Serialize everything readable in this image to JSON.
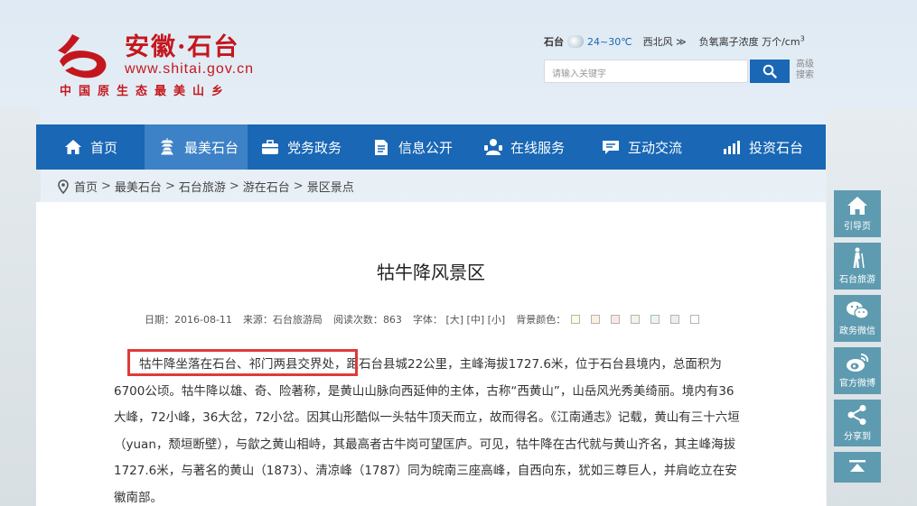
{
  "site": {
    "name": "安徽·石台",
    "url": "www.shitai.gov.cn",
    "slogan": "中国原生态最美山乡",
    "brand_color": "#c4171d"
  },
  "weather": {
    "city": "石台",
    "icon": "cloudy-icon",
    "temp": "24~30℃",
    "wind": "西北风 ≫",
    "ion_label": "负氧离子浓度 万个/cm",
    "ion_unit_sup": "3"
  },
  "search": {
    "placeholder": "请输入关键字",
    "advanced_label": "高级搜索"
  },
  "nav": {
    "accent": "#1967b5",
    "items": [
      {
        "label": "首页",
        "icon": "home-icon"
      },
      {
        "label": "最美石台",
        "icon": "pagoda-icon",
        "active": true
      },
      {
        "label": "党务政务",
        "icon": "briefcase-icon"
      },
      {
        "label": "信息公开",
        "icon": "document-icon"
      },
      {
        "label": "在线服务",
        "icon": "service-icon"
      },
      {
        "label": "互动交流",
        "icon": "chat-icon"
      },
      {
        "label": "投资石台",
        "icon": "chart-icon"
      }
    ]
  },
  "breadcrumb": {
    "items": [
      "首页",
      "最美石台",
      "石台旅游",
      "游在石台",
      "景区景点"
    ],
    "separator": ">"
  },
  "article": {
    "title": "牯牛降风景区",
    "date_label": "日期：2016-08-11",
    "source_label": "来源：石台旅游局",
    "views_label": "阅读次数：",
    "views": "863",
    "font_label": "字体：",
    "font_large": "[大]",
    "font_medium": "[中]",
    "font_small": "[小]",
    "bg_label": "背景颜色：",
    "bg_colors": [
      "#fbfbe4",
      "#faf0e0",
      "#fbe8e4",
      "#eef6e8",
      "#e8f6f0",
      "#eeeeee",
      "#ffffff"
    ],
    "highlighted_text": "牯牛降坐落在石台、祁门两县交界处，",
    "body_rest": "距石台县城22公里，主峰海拔1727.6米，位于石台县境内，总面积为6700公顷。牯牛降以雄、奇、险著称，是黄山山脉向西延伸的主体，古称“西黄山”，山岳风光秀美绮丽。境内有36大峰，72小峰，36大岔，72小岔。因其山形酷似一头牯牛顶天而立，故而得名。《江南通志》记载，黄山有三十六垣（yuan，颓垣断壁），与歙之黄山相峙，其最高者古牛岗可望匡庐。可见，牯牛降在古代就与黄山齐名，其主峰海拔1727.6米，与著名的黄山（1873）、清凉峰（1787）同为皖南三座高峰，自西向东，犹如三尊巨人，并肩屹立在安徽南部。"
  },
  "side_bar": {
    "items": [
      {
        "label": "引导页",
        "icon": "home-icon"
      },
      {
        "label": "石台旅游",
        "icon": "hiker-icon"
      },
      {
        "label": "政务微信",
        "icon": "wechat-icon"
      },
      {
        "label": "官方微博",
        "icon": "weibo-icon"
      },
      {
        "label": "分享到",
        "icon": "share-icon"
      }
    ],
    "top_icon": "back-to-top-icon",
    "color": "#5e9bb0"
  }
}
